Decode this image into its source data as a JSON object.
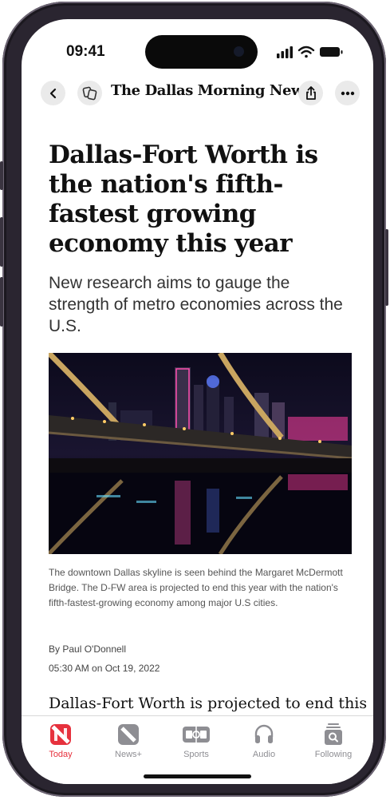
{
  "status_bar": {
    "time": "09:41"
  },
  "nav": {
    "publisher": "The Dallas Morning News",
    "back_icon": "chevron-left-icon",
    "share_icon": "share-icon",
    "more_icon": "ellipsis-icon"
  },
  "article": {
    "headline": "Dallas-Fort Worth is the nation's fifth-fastest growing economy this year",
    "subhead": "New research aims to gauge the strength of metro economies across the U.S.",
    "caption": "The downtown Dallas skyline is seen behind the Margaret McDermott Bridge. The D-FW area is projected to end this year with the nation's fifth-fastest-growing economy among major U.S cities.",
    "byline": "By Paul O'Donnell",
    "date": "05:30 AM on Oct 19, 2022",
    "body_preview": "Dallas-Fort Worth is projected to end this"
  },
  "tabs": [
    {
      "label": "Today",
      "icon": "news-icon",
      "active": true
    },
    {
      "label": "News+",
      "icon": "news-plus-icon",
      "active": false
    },
    {
      "label": "Sports",
      "icon": "sports-icon",
      "active": false
    },
    {
      "label": "Audio",
      "icon": "headphones-icon",
      "active": false
    },
    {
      "label": "Following",
      "icon": "following-icon",
      "active": false
    }
  ],
  "colors": {
    "accent": "#e6313d",
    "inactive": "#8e8e93"
  }
}
